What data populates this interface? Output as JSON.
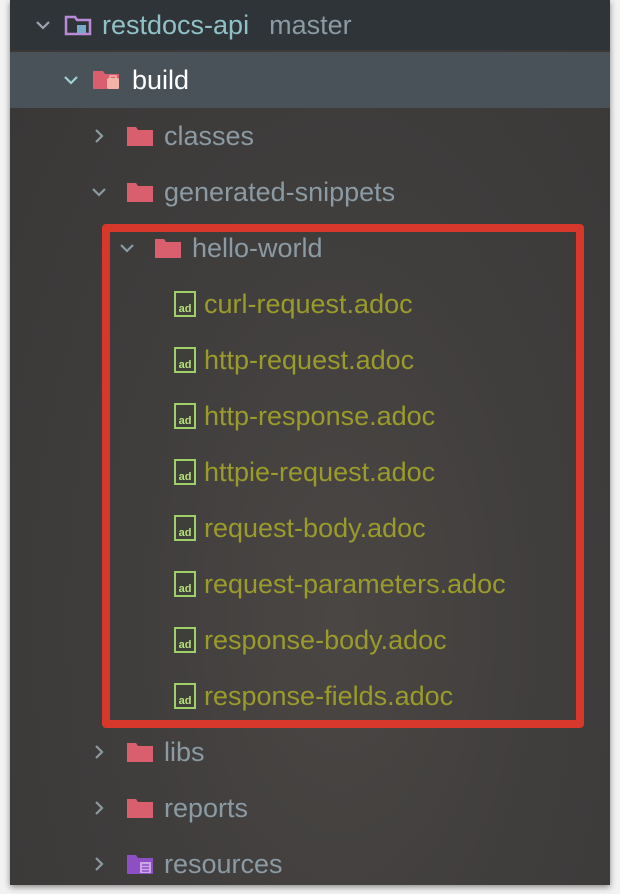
{
  "project": {
    "name": "restdocs-api",
    "branch": "master"
  },
  "tree": {
    "build": "build",
    "classes": "classes",
    "generated_snippets": "generated-snippets",
    "hello_world": "hello-world",
    "files": [
      "curl-request.adoc",
      "http-request.adoc",
      "http-response.adoc",
      "httpie-request.adoc",
      "request-body.adoc",
      "request-parameters.adoc",
      "response-body.adoc",
      "response-fields.adoc"
    ],
    "libs": "libs",
    "reports": "reports",
    "resources": "resources"
  },
  "colors": {
    "panel_bg": "#403e3d",
    "header_bg": "#2f3439",
    "selected_bg": "#495259",
    "folder_red": "#d95f6f",
    "file_text": "#9a9b2a",
    "highlight": "#d8372b"
  },
  "icons": {
    "expanded": "chevron-down-icon",
    "collapsed": "chevron-right-icon",
    "folder": "folder-icon",
    "module": "module-icon",
    "asciidoc": "asciidoc-file-icon",
    "resources": "resources-folder-icon"
  }
}
